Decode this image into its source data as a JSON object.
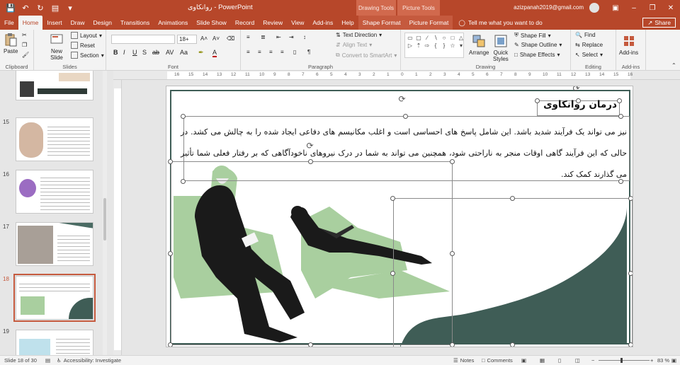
{
  "titlebar": {
    "title": "روانکاوی  -  PowerPoint",
    "context_drawing": "Drawing Tools",
    "context_picture": "Picture Tools",
    "account": "azizpanah2019@gmail.com",
    "accent": "#b7472a"
  },
  "tabs": [
    {
      "label": "File"
    },
    {
      "label": "Home"
    },
    {
      "label": "Insert"
    },
    {
      "label": "Draw"
    },
    {
      "label": "Design"
    },
    {
      "label": "Transitions"
    },
    {
      "label": "Animations"
    },
    {
      "label": "Slide Show"
    },
    {
      "label": "Record"
    },
    {
      "label": "Review"
    },
    {
      "label": "View"
    },
    {
      "label": "Add-ins"
    },
    {
      "label": "Help"
    },
    {
      "label": "Shape Format"
    },
    {
      "label": "Picture Format"
    }
  ],
  "tell_me": "Tell me what you want to do",
  "share_label": "Share",
  "ribbon": {
    "clipboard": {
      "paste": "Paste",
      "label": "Clipboard"
    },
    "slides": {
      "new_slide": "New\nSlide",
      "layout": "Layout",
      "reset": "Reset",
      "section": "Section",
      "label": "Slides"
    },
    "font": {
      "name": "",
      "size": "18+",
      "label": "Font"
    },
    "paragraph": {
      "text_direction": "Text Direction",
      "align_text": "Align Text",
      "smartart": "Convert to SmartArt",
      "label": "Paragraph"
    },
    "drawing": {
      "arrange": "Arrange",
      "quick_styles": "Quick\nStyles",
      "shape_fill": "Shape Fill",
      "shape_outline": "Shape Outline",
      "shape_effects": "Shape Effects",
      "label": "Drawing"
    },
    "editing": {
      "find": "Find",
      "replace": "Replace",
      "select": "Select",
      "label": "Editing"
    },
    "addins": {
      "addins": "Add-ins",
      "label": "Add-ins"
    }
  },
  "ruler_marks": [
    "16",
    "15",
    "14",
    "13",
    "12",
    "11",
    "10",
    "9",
    "8",
    "7",
    "6",
    "5",
    "4",
    "3",
    "2",
    "1",
    "0",
    "1",
    "2",
    "3",
    "4",
    "5",
    "6",
    "7",
    "8",
    "9",
    "10",
    "11",
    "12",
    "13",
    "14",
    "15",
    "16"
  ],
  "thumbnails": [
    {
      "num": "",
      "selected": false
    },
    {
      "num": "15",
      "selected": false
    },
    {
      "num": "16",
      "selected": false
    },
    {
      "num": "17",
      "selected": false
    },
    {
      "num": "18",
      "selected": true
    },
    {
      "num": "19",
      "selected": false
    }
  ],
  "slide": {
    "title": "درمان روانکاوی",
    "body": "نیز می تواند یک فرآیند شدید باشد. این شامل پاسخ های احساسی است و اغلب مکانیسم های دفاعی ایجاد شده را به چالش می کشد. در حالی که این فرآیند گاهی اوقات منجر به ناراحتی شود، همچنین می تواند به شما در درک نیروهای ناخودآگاهی که بر رفتار فعلی شما تأثیر می گذارند کمک کند.",
    "colors": {
      "frame": "#3f5d56",
      "wave": "#3f5d56",
      "chair": "#a9cf9f",
      "ink": "#1a1a1a"
    }
  },
  "status": {
    "slide_info": "Slide 18 of 30",
    "accessibility": "Accessibility: Investigate",
    "notes": "Notes",
    "comments": "Comments",
    "zoom": "83 %"
  }
}
